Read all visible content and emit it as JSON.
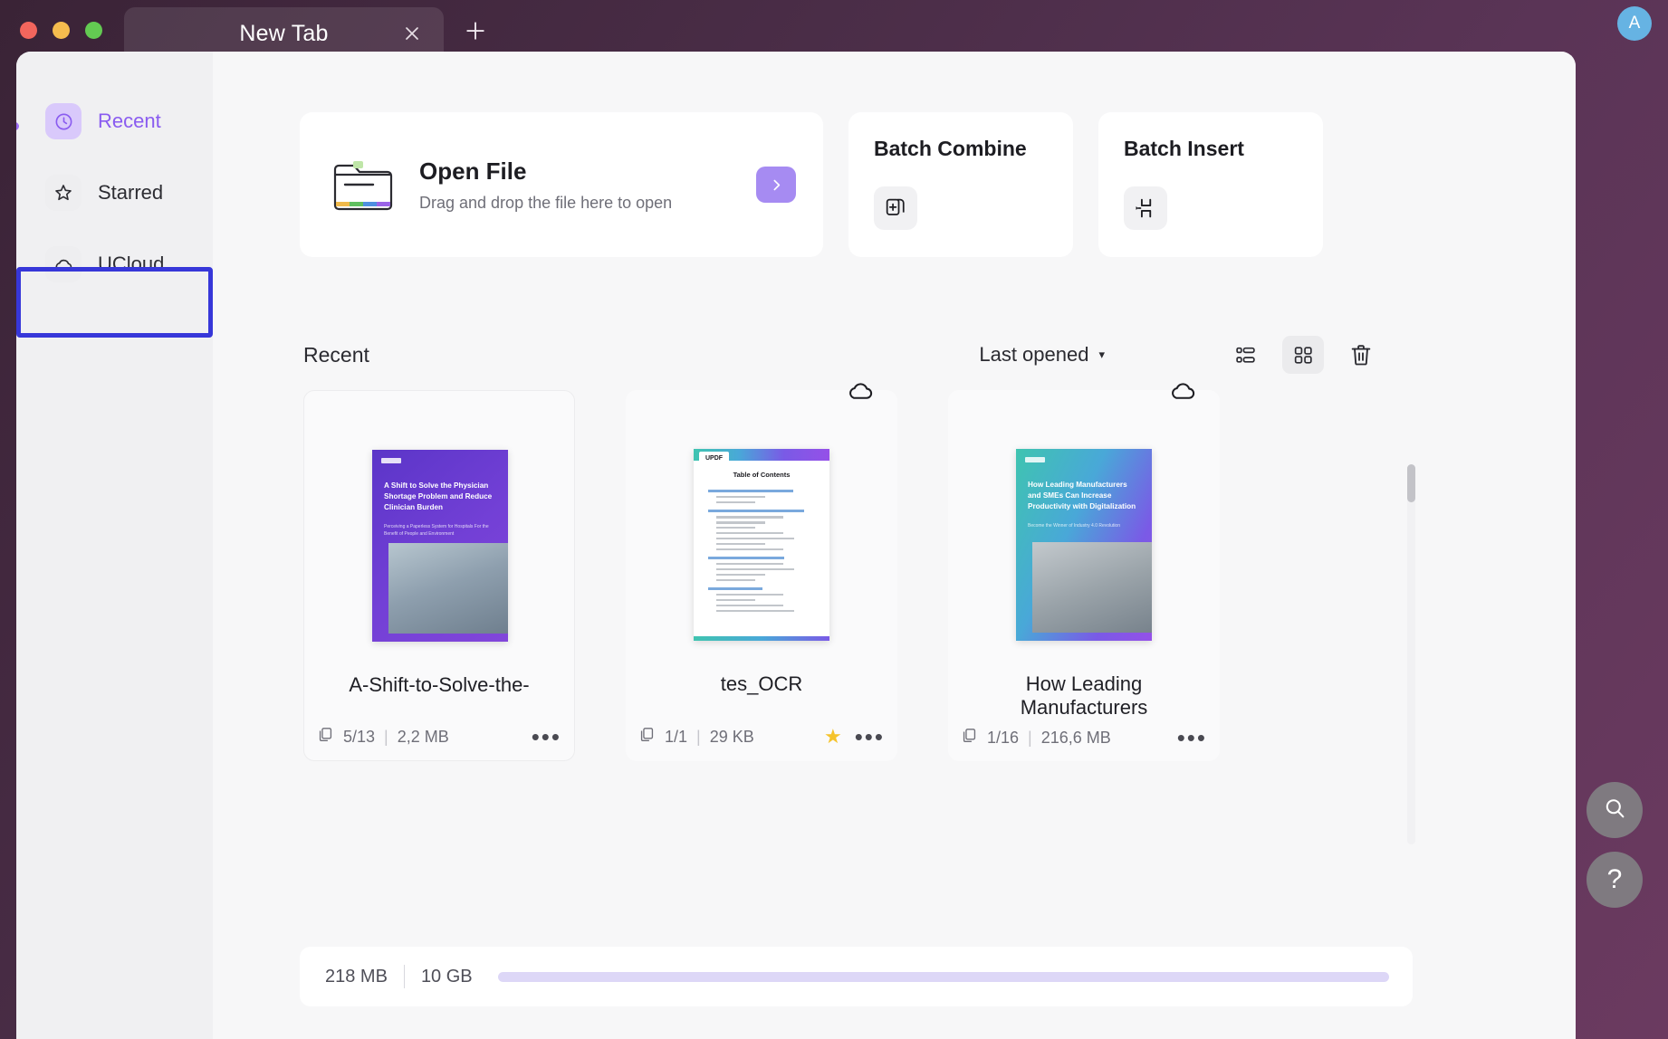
{
  "window": {
    "tab_title": "New Tab",
    "avatar_initial": "A",
    "close_icon": "close-icon",
    "new_tab_icon": "plus-icon"
  },
  "sidebar": {
    "items": [
      {
        "label": "Recent",
        "icon": "clock-icon",
        "active": true
      },
      {
        "label": "Starred",
        "icon": "star-icon",
        "active": false
      },
      {
        "label": "UCloud",
        "icon": "cloud-icon",
        "active": false,
        "focused": true
      }
    ]
  },
  "open_file_card": {
    "title": "Open File",
    "subtitle": "Drag and drop the file here to open",
    "icon": "folder-icon",
    "action_icon": "chevron-right-icon"
  },
  "batch_cards": [
    {
      "title": "Batch Combine",
      "icon": "combine-pages-icon"
    },
    {
      "title": "Batch Insert",
      "icon": "insert-pages-icon"
    }
  ],
  "recent": {
    "heading": "Recent",
    "sort_label": "Last opened",
    "sort_caret": "▾",
    "view_list_icon": "list-view-icon",
    "view_grid_icon": "grid-view-icon",
    "delete_icon": "trash-icon",
    "files": [
      {
        "name": "A-Shift-to-Solve-the-",
        "pages": "5/13",
        "size": "2,2 MB",
        "starred": false,
        "cloud": false,
        "thumb_title": "A Shift to Solve the Physician Shortage Problem and Reduce Clinician Burden",
        "thumb_subtitle": "Perceiving a Paperless System for Hospitals For the Benefit of People and Environment"
      },
      {
        "name": "tes_OCR",
        "pages": "1/1",
        "size": "29 KB",
        "starred": true,
        "cloud": true,
        "thumb_title": "Table of Contents",
        "thumb_badge": "UPDF"
      },
      {
        "name": "How Leading Manufacturers",
        "pages": "1/16",
        "size": "216,6 MB",
        "starred": false,
        "cloud": true,
        "thumb_title": "How Leading Manufacturers and SMEs Can Increase Productivity with Digitalization",
        "thumb_subtitle": "Become the Winner of Industry 4.0 Revolution"
      }
    ]
  },
  "storage": {
    "used": "218 MB",
    "separator": "|",
    "total": "10 GB",
    "percent": 2.1
  },
  "floating": {
    "search_icon": "search-icon",
    "help_label": "?"
  },
  "colors": {
    "accent_purple": "#8a5cf0",
    "focus_blue": "#3737d9",
    "star_yellow": "#f5c32c",
    "avatar_blue": "#66b3e3"
  }
}
